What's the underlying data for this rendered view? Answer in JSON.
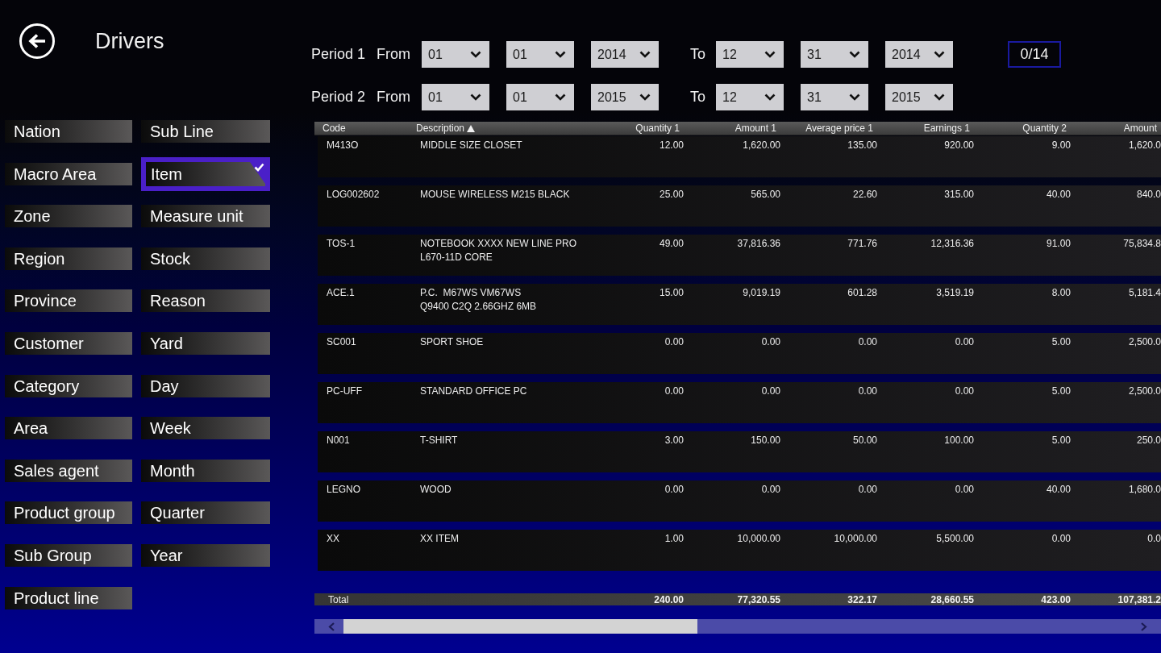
{
  "header": {
    "title": "Drivers"
  },
  "periods": [
    {
      "label": "Period 1",
      "from_label": "From",
      "from": [
        "01",
        "01",
        "2014"
      ],
      "to_label": "To",
      "to": [
        "12",
        "31",
        "2014"
      ]
    },
    {
      "label": "Period 2",
      "from_label": "From",
      "from": [
        "01",
        "01",
        "2015"
      ],
      "to_label": "To",
      "to": [
        "12",
        "31",
        "2015"
      ]
    }
  ],
  "counter": "0/14",
  "driver_columns": [
    {
      "items": [
        {
          "label": "Nation",
          "selected": false
        },
        {
          "label": "Macro Area",
          "selected": false
        },
        {
          "label": "Zone",
          "selected": false
        },
        {
          "label": "Region",
          "selected": false
        },
        {
          "label": "Province",
          "selected": false
        },
        {
          "label": "Customer",
          "selected": false
        },
        {
          "label": "Category",
          "selected": false
        },
        {
          "label": "Area",
          "selected": false
        },
        {
          "label": "Sales agent",
          "selected": false
        },
        {
          "label": "Product group",
          "selected": false
        },
        {
          "label": "Sub Group",
          "selected": false
        },
        {
          "label": "Product line",
          "selected": false
        }
      ]
    },
    {
      "items": [
        {
          "label": "Sub Line",
          "selected": false
        },
        {
          "label": "Item",
          "selected": true
        },
        {
          "label": "Measure unit",
          "selected": false
        },
        {
          "label": "Stock",
          "selected": false
        },
        {
          "label": "Reason",
          "selected": false
        },
        {
          "label": "Yard",
          "selected": false
        },
        {
          "label": "Day",
          "selected": false
        },
        {
          "label": "Week",
          "selected": false
        },
        {
          "label": "Month",
          "selected": false
        },
        {
          "label": "Quarter",
          "selected": false
        },
        {
          "label": "Year",
          "selected": false
        }
      ]
    }
  ],
  "table": {
    "columns": [
      {
        "label": "Code",
        "sorted": false
      },
      {
        "label": "Description",
        "sorted": true
      },
      {
        "label": "Quantity 1",
        "sorted": false
      },
      {
        "label": "Amount 1",
        "sorted": false
      },
      {
        "label": "Average price 1",
        "sorted": false
      },
      {
        "label": "Earnings 1",
        "sorted": false
      },
      {
        "label": "Quantity 2",
        "sorted": false
      },
      {
        "label": "Amount",
        "sorted": false
      }
    ],
    "rows": [
      {
        "cells": [
          "M413O",
          "MIDDLE SIZE CLOSET",
          "12.00",
          "1,620.00",
          "135.00",
          "920.00",
          "9.00",
          "1,620.0"
        ]
      },
      {
        "cells": [
          "LOG002602",
          "MOUSE WIRELESS M215 BLACK",
          "25.00",
          "565.00",
          "22.60",
          "315.00",
          "40.00",
          "840.0"
        ]
      },
      {
        "cells": [
          "TOS-1",
          "NOTEBOOK XXXX NEW LINE PRO\nL670-11D CORE",
          "49.00",
          "37,816.36",
          "771.76",
          "12,316.36",
          "91.00",
          "75,834.8"
        ]
      },
      {
        "cells": [
          "ACE.1",
          "P.C.  M67WS VM67WS\nQ9400 C2Q 2.66GHZ 6MB",
          "15.00",
          "9,019.19",
          "601.28",
          "3,519.19",
          "8.00",
          "5,181.4"
        ]
      },
      {
        "cells": [
          "SC001",
          "SPORT SHOE",
          "0.00",
          "0.00",
          "0.00",
          "0.00",
          "5.00",
          "2,500.0"
        ]
      },
      {
        "cells": [
          "PC-UFF",
          "STANDARD OFFICE PC",
          "0.00",
          "0.00",
          "0.00",
          "0.00",
          "5.00",
          "2,500.0"
        ]
      },
      {
        "cells": [
          "N001",
          "T-SHIRT",
          "3.00",
          "150.00",
          "50.00",
          "100.00",
          "5.00",
          "250.0"
        ]
      },
      {
        "cells": [
          "LEGNO",
          "WOOD",
          "0.00",
          "0.00",
          "0.00",
          "0.00",
          "40.00",
          "1,680.0"
        ]
      },
      {
        "cells": [
          "XX",
          "XX ITEM",
          "1.00",
          "10,000.00",
          "10,000.00",
          "5,500.00",
          "0.00",
          "0.0"
        ]
      }
    ],
    "total": {
      "label": "Total",
      "cells": [
        "240.00",
        "77,320.55",
        "322.17",
        "28,660.55",
        "423.00",
        "107,381.2"
      ]
    }
  }
}
